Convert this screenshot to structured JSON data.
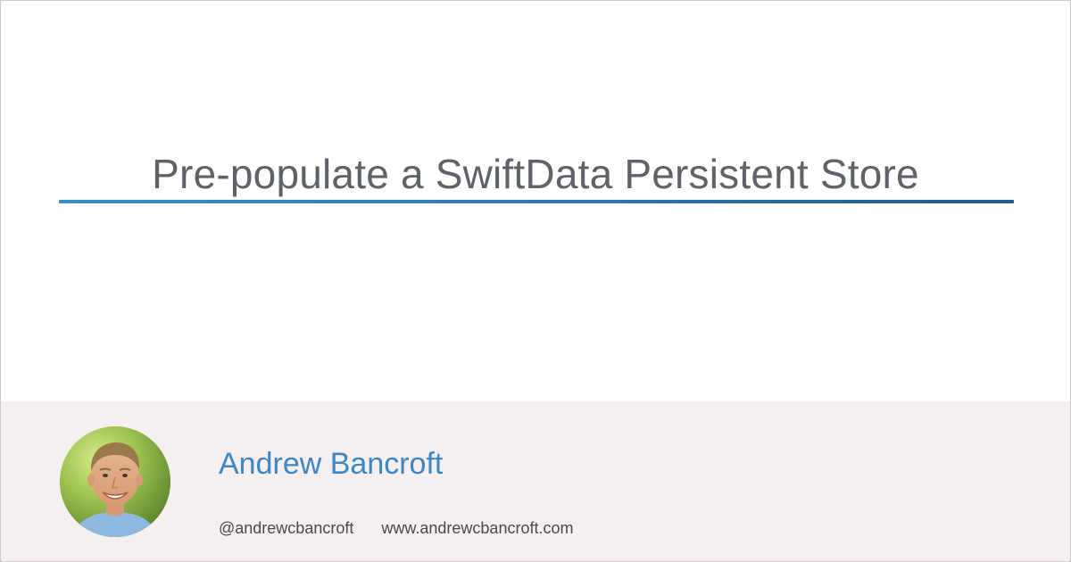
{
  "post": {
    "title": "Pre-populate a SwiftData Persistent Store"
  },
  "author": {
    "name": "Andrew Bancroft",
    "handle": "@andrewcbancroft",
    "website": "www.andrewcbancroft.com",
    "avatar_icon": "author-photo"
  },
  "colors": {
    "title_text": "#5f6368",
    "accent_blue": "#3d87c4",
    "rule_start": "#3b8dc9",
    "rule_end": "#25598a",
    "footer_bg": "#f5efef"
  }
}
